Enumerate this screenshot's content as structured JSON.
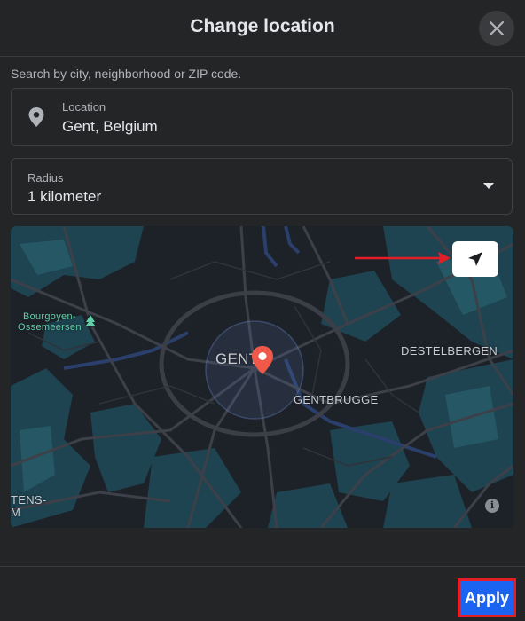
{
  "dialog": {
    "title": "Change location",
    "hint": "Search by city, neighborhood or ZIP code.",
    "close_icon": "close-icon"
  },
  "location_field": {
    "label": "Location",
    "value": "Gent, Belgium",
    "icon": "map-pin-icon"
  },
  "radius_field": {
    "label": "Radius",
    "value": "1 kilometer",
    "icon": "caret-down-icon"
  },
  "map": {
    "labels": {
      "bourgoyen_line1": "Bourgoyen-",
      "bourgoyen_line2": "Ossemeersen",
      "gent": "GENT",
      "destelbergen": "DESTELBERGEN",
      "gentbrugge": "GENTBRUGGE",
      "tens": "TENS-",
      "tens_line2": "M"
    },
    "locate_icon": "navigation-arrow-icon",
    "info_icon_text": "i",
    "pin_color": "#f0584a"
  },
  "footer": {
    "apply_label": "Apply",
    "apply_color": "#1b63f1",
    "highlight_color": "#e41e26"
  }
}
